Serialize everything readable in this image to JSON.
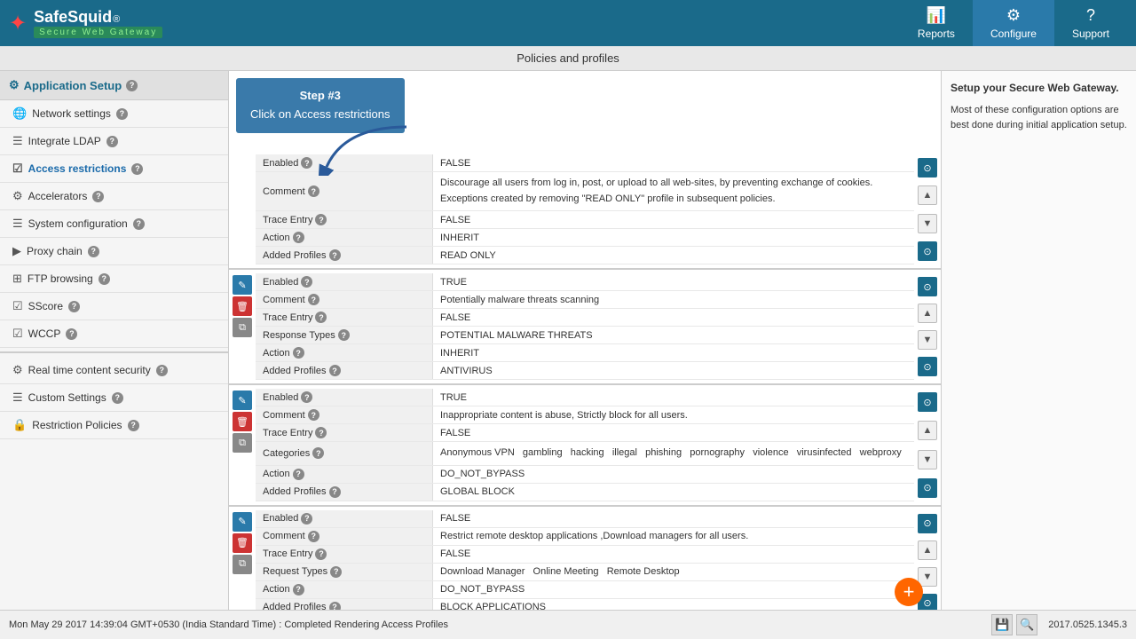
{
  "header": {
    "logo_main": "SafeSquid",
    "logo_registered": "®",
    "logo_sub": "Secure Web Gateway",
    "nav_items": [
      {
        "id": "reports",
        "label": "Reports",
        "icon": "📊"
      },
      {
        "id": "configure",
        "label": "Configure",
        "icon": "⚙",
        "active": true
      },
      {
        "id": "support",
        "label": "Support",
        "icon": "?"
      }
    ]
  },
  "page_title": "Policies and profiles",
  "sidebar": {
    "section_title": "Application Setup",
    "items": [
      {
        "id": "network-settings",
        "label": "Network settings",
        "icon": "🌐"
      },
      {
        "id": "integrate-ldap",
        "label": "Integrate LDAP",
        "icon": "☰"
      },
      {
        "id": "access-restrictions",
        "label": "Access restrictions",
        "icon": "☑",
        "active": true
      },
      {
        "id": "accelerators",
        "label": "Accelerators",
        "icon": "⚙"
      },
      {
        "id": "system-configuration",
        "label": "System configuration",
        "icon": "☰"
      },
      {
        "id": "proxy-chain",
        "label": "Proxy chain",
        "icon": "▶"
      },
      {
        "id": "ftp-browsing",
        "label": "FTP browsing",
        "icon": "⊞"
      },
      {
        "id": "sscore",
        "label": "SScore",
        "icon": "☑"
      },
      {
        "id": "wccp",
        "label": "WCCP",
        "icon": "☑"
      },
      {
        "id": "real-time-content-security",
        "label": "Real time content security",
        "icon": "⚙"
      },
      {
        "id": "custom-settings",
        "label": "Custom Settings",
        "icon": "☰"
      },
      {
        "id": "restriction-policies",
        "label": "Restriction Policies",
        "icon": "🔒"
      }
    ]
  },
  "callout": {
    "step": "Step #3",
    "text": "Click on Access restrictions"
  },
  "policies": [
    {
      "id": "policy1",
      "fields": [
        {
          "label": "Enabled",
          "value": "FALSE",
          "has_help": true
        },
        {
          "label": "Comment",
          "value": "Discourage all users from log in, post, or upload to all web-sites, by preventing exchange of cookies.",
          "has_help": true,
          "multiline": true
        },
        {
          "label": "",
          "value": "Exceptions created by removing \"READ ONLY\" profile in subsequent policies.",
          "multiline": true
        },
        {
          "label": "Trace Entry",
          "value": "FALSE",
          "has_help": true
        },
        {
          "label": "Action",
          "value": "INHERIT",
          "has_help": true
        },
        {
          "label": "Added Profiles",
          "value": "READ ONLY",
          "has_help": true
        }
      ]
    },
    {
      "id": "policy2",
      "fields": [
        {
          "label": "Enabled",
          "value": "TRUE",
          "has_help": true
        },
        {
          "label": "Comment",
          "value": "Potentially malware threats scanning",
          "has_help": true
        },
        {
          "label": "Trace Entry",
          "value": "FALSE",
          "has_help": true
        },
        {
          "label": "Response Types",
          "value": "POTENTIAL MALWARE THREATS",
          "has_help": true
        },
        {
          "label": "Action",
          "value": "INHERIT",
          "has_help": true
        },
        {
          "label": "Added Profiles",
          "value": "ANTIVIRUS",
          "has_help": true
        }
      ]
    },
    {
      "id": "policy3",
      "fields": [
        {
          "label": "Enabled",
          "value": "TRUE",
          "has_help": true
        },
        {
          "label": "Comment",
          "value": "Inappropriate content is abuse, Strictly block for all users.",
          "has_help": true
        },
        {
          "label": "Trace Entry",
          "value": "FALSE",
          "has_help": true
        },
        {
          "label": "Categories",
          "value": "Anonymous VPN  gambling  hacking  illegal  phishing  pornography  violence  virusinfected  webproxy",
          "has_help": true,
          "multiline": true
        },
        {
          "label": "Action",
          "value": "DO_NOT_BYPASS",
          "has_help": true
        },
        {
          "label": "Added Profiles",
          "value": "GLOBAL BLOCK",
          "has_help": true
        }
      ]
    },
    {
      "id": "policy4",
      "fields": [
        {
          "label": "Enabled",
          "value": "FALSE",
          "has_help": true
        },
        {
          "label": "Comment",
          "value": "Restrict remote desktop applications ,Download managers for all users.",
          "has_help": true
        },
        {
          "label": "Trace Entry",
          "value": "FALSE",
          "has_help": true
        },
        {
          "label": "Request Types",
          "value": "Download Manager  Online Meeting  Remote Desktop",
          "has_help": true
        },
        {
          "label": "Action",
          "value": "DO_NOT_BYPASS",
          "has_help": true
        },
        {
          "label": "Added Profiles",
          "value": "BLOCK APPLICATIONS",
          "has_help": true
        }
      ]
    }
  ],
  "right_panel": {
    "title": "Setup your Secure Web Gateway.",
    "text": "Most of these configuration options are best done during initial application setup."
  },
  "bottom_bar": {
    "status": "Mon May 29 2017 14:39:04 GMT+0530 (India Standard Time) : Completed Rendering Access Profiles",
    "version": "2017.0525.1345.3"
  },
  "add_button_label": "+"
}
